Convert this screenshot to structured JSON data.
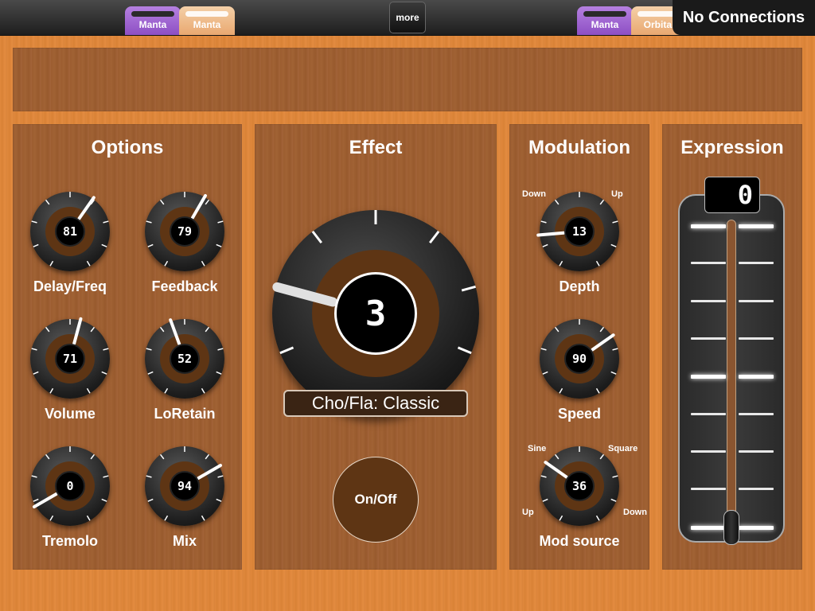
{
  "header": {
    "tabs_left": [
      {
        "label": "Manta",
        "style": "purple"
      },
      {
        "label": "Manta",
        "style": "peach"
      }
    ],
    "more_label": "more",
    "tabs_right": [
      {
        "label": "Manta",
        "style": "purple"
      },
      {
        "label": "Orbital",
        "style": "peach"
      }
    ],
    "connection_status": "No Connections"
  },
  "options": {
    "title": "Options",
    "knobs": [
      {
        "label": "Delay/Freq",
        "value": "81"
      },
      {
        "label": "Feedback",
        "value": "79"
      },
      {
        "label": "Volume",
        "value": "71"
      },
      {
        "label": "LoRetain",
        "value": "52"
      },
      {
        "label": "Tremolo",
        "value": "0"
      },
      {
        "label": "Mix",
        "value": "94"
      }
    ]
  },
  "effect": {
    "title": "Effect",
    "value": "3",
    "preset": "Cho/Fla: Classic",
    "onoff_label": "On/Off"
  },
  "modulation": {
    "title": "Modulation",
    "depth": {
      "label": "Depth",
      "value": "13",
      "min_label": "Down",
      "max_label": "Up"
    },
    "speed": {
      "label": "Speed",
      "value": "90"
    },
    "mod_source": {
      "label": "Mod source",
      "value": "36",
      "top_left": "Sine",
      "top_right": "Square",
      "bottom_left": "Up",
      "bottom_right": "Down"
    }
  },
  "expression": {
    "title": "Expression",
    "value": "0"
  },
  "colors": {
    "background": "#e0883c",
    "panel": "#9c5d30",
    "knob_ring": "#5e3514",
    "tab_purple": "#8d4fc4",
    "tab_peach": "#e9a870"
  }
}
